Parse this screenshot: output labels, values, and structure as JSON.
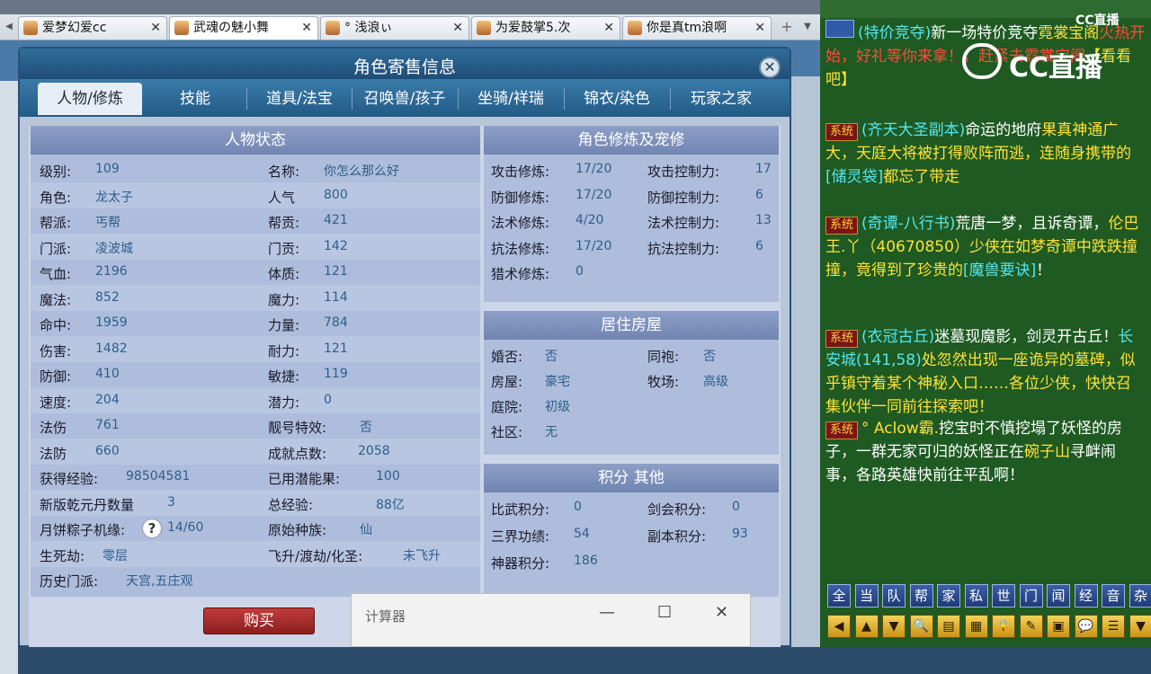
{
  "browser": {
    "tabs": [
      {
        "label": "爱梦幻爱cc",
        "active": false
      },
      {
        "label": "武魂の魅小舞",
        "active": true
      },
      {
        "label": "° 浅浪ぃ",
        "active": false
      },
      {
        "label": "为爱鼓掌5.次",
        "active": false
      },
      {
        "label": "你是真tm浪啊",
        "active": false
      }
    ],
    "tab_close_glyph": "✕",
    "new_tab_glyph": "+",
    "nav_left_glyph": "◀",
    "nav_right_glyph": "▼"
  },
  "dialog": {
    "title": "角色寄售信息",
    "close_glyph": "✕",
    "tabs": [
      "人物/修炼",
      "技能",
      "道具/法宝",
      "召唤兽/孩子",
      "坐骑/祥瑞",
      "锦衣/染色",
      "玩家之家"
    ],
    "active_tab": "人物/修炼",
    "status_panel": {
      "title": "人物状态",
      "left_col": [
        {
          "label": "级别:",
          "value": "109"
        },
        {
          "label": "角色:",
          "value": "龙太子"
        },
        {
          "label": "帮派:",
          "value": "丐帮"
        },
        {
          "label": "门派:",
          "value": "凌波城"
        },
        {
          "label": "气血:",
          "value": "2196"
        },
        {
          "label": "魔法:",
          "value": "852"
        },
        {
          "label": "命中:",
          "value": "1959"
        },
        {
          "label": "伤害:",
          "value": "1482"
        },
        {
          "label": "防御:",
          "value": "410"
        },
        {
          "label": "速度:",
          "value": "204"
        },
        {
          "label": "法伤",
          "value": "761"
        },
        {
          "label": "法防",
          "value": "660"
        },
        {
          "label": "获得经验:",
          "value": "98504581"
        },
        {
          "label": "新版乾元丹数量",
          "value": "3"
        },
        {
          "label": "月饼粽子机缘:",
          "value": "14/60"
        },
        {
          "label": "生死劫:",
          "value": "零层"
        },
        {
          "label": "历史门派:",
          "value": "天宫,五庄观"
        }
      ],
      "right_col": [
        {
          "label": "名称:",
          "value": "你怎么那么好"
        },
        {
          "label": "人气",
          "value": "800"
        },
        {
          "label": "帮贡:",
          "value": "421"
        },
        {
          "label": "门贡:",
          "value": "142"
        },
        {
          "label": "体质:",
          "value": "121"
        },
        {
          "label": "魔力:",
          "value": "114"
        },
        {
          "label": "力量:",
          "value": "784"
        },
        {
          "label": "耐力:",
          "value": "121"
        },
        {
          "label": "敏捷:",
          "value": "119"
        },
        {
          "label": "潜力:",
          "value": "0"
        },
        {
          "label": "靓号特效:",
          "value": "否"
        },
        {
          "label": "成就点数:",
          "value": "2058"
        },
        {
          "label": "已用潜能果:",
          "value": "100"
        },
        {
          "label": "总经验:",
          "value": "88亿"
        },
        {
          "label": "原始种族:",
          "value": "仙"
        },
        {
          "label": "飞升/渡劫/化圣:",
          "value": "未飞升"
        }
      ],
      "help_glyph": "?"
    },
    "cultivation_panel": {
      "title": "角色修炼及宠修",
      "rows": [
        {
          "label": "攻击修炼:",
          "value": "17/20",
          "label2": "攻击控制力:",
          "value2": "17"
        },
        {
          "label": "防御修炼:",
          "value": "17/20",
          "label2": "防御控制力:",
          "value2": "6"
        },
        {
          "label": "法术修炼:",
          "value": "4/20",
          "label2": "法术控制力:",
          "value2": "13"
        },
        {
          "label": "抗法修炼:",
          "value": "17/20",
          "label2": "抗法控制力:",
          "value2": "6"
        },
        {
          "label": "猎术修炼:",
          "value": "0"
        }
      ]
    },
    "house_panel": {
      "title": "居住房屋",
      "rows": [
        {
          "label": "婚否:",
          "value": "否",
          "label2": "同袍:",
          "value2": "否"
        },
        {
          "label": "房屋:",
          "value": "豪宅",
          "label2": "牧场:",
          "value2": "高级"
        },
        {
          "label": "庭院:",
          "value": "初级"
        },
        {
          "label": "社区:",
          "value": "无"
        }
      ]
    },
    "score_panel": {
      "title": "积分 其他",
      "rows": [
        {
          "label": "比武积分:",
          "value": "0",
          "label2": "剑会积分:",
          "value2": "0"
        },
        {
          "label": "三界功绩:",
          "value": "54",
          "label2": "副本积分:",
          "value2": "93"
        },
        {
          "label": "神器积分:",
          "value": "186"
        }
      ]
    },
    "buy_label": "购买"
  },
  "calculator": {
    "title": "计算器",
    "minimize": "—",
    "maximize": "☐",
    "close": "✕"
  },
  "chat": {
    "cc_logo_small": "CC直播",
    "cc_logo": "CC直播",
    "messages": [
      {
        "tag": "",
        "parts": [
          {
            "c": "cyan",
            "t": "(特价竞夺)"
          },
          {
            "c": "wht",
            "t": "新一场特价竞夺"
          },
          {
            "c": "yel",
            "t": "霓裳宝阁"
          },
          {
            "c": "red",
            "t": "火热开始，好礼等你来拿！"
          },
          {
            "c": "red",
            "t": "，赶紧去霓裳宝阁"
          },
          {
            "c": "yel",
            "t": "【看看吧】"
          }
        ]
      },
      {
        "tag": "系统",
        "parts": [
          {
            "c": "cyan",
            "t": "(齐天大圣副本)"
          },
          {
            "c": "wht",
            "t": "命运的地府"
          },
          {
            "c": "yel",
            "t": "果真神通广大，天庭大将被打得败阵而逃，连随身携带的"
          },
          {
            "c": "cyan",
            "t": "[储灵袋]"
          },
          {
            "c": "yel",
            "t": "都忘了带走"
          }
        ]
      },
      {
        "tag": "系统",
        "parts": [
          {
            "c": "cyan",
            "t": "(奇谭-八行书)"
          },
          {
            "c": "wht",
            "t": "荒唐一梦，且诉奇谭，"
          },
          {
            "c": "yel",
            "t": "伦巴王.丫（"
          },
          {
            "c": "yel",
            "t": "40670850"
          },
          {
            "c": "yel",
            "t": "）少侠在如梦奇谭中跌跌撞撞，竟得到了珍贵的"
          },
          {
            "c": "cyan",
            "t": "[魔兽要诀]"
          },
          {
            "c": "wht",
            "t": "！"
          }
        ]
      },
      {
        "tag": "系统",
        "parts": [
          {
            "c": "cyan",
            "t": "(衣冠古丘)"
          },
          {
            "c": "wht",
            "t": "迷墓现魔影，剑灵开古丘！"
          },
          {
            "c": "cyan",
            "t": "长安城(141,58)"
          },
          {
            "c": "yel",
            "t": "处忽然出现一座诡异的墓碑，似乎镇守着某个神秘入口……各位少侠，快快召集伙伴一同前往探索吧！"
          }
        ]
      },
      {
        "tag": "系统",
        "parts": [
          {
            "c": "yel",
            "t": "° Aclow霸."
          },
          {
            "c": "wht",
            "t": "挖宝时不慎挖塌了妖怪的房子，一群无家可归的妖怪正在"
          },
          {
            "c": "yel",
            "t": "碗子山"
          },
          {
            "c": "wht",
            "t": "寻衅闹事，各路英雄快前往平乱啊！"
          }
        ]
      }
    ],
    "channel_buttons": [
      "全",
      "当",
      "队",
      "帮",
      "家",
      "私",
      "世",
      "门",
      "闻",
      "经",
      "音",
      "杂"
    ],
    "tool_buttons": [
      "◀",
      "▲",
      "▼",
      "🔍",
      "▤",
      "▦",
      "🔒",
      "✎",
      "▣",
      "💬",
      "☰",
      "▼"
    ]
  }
}
